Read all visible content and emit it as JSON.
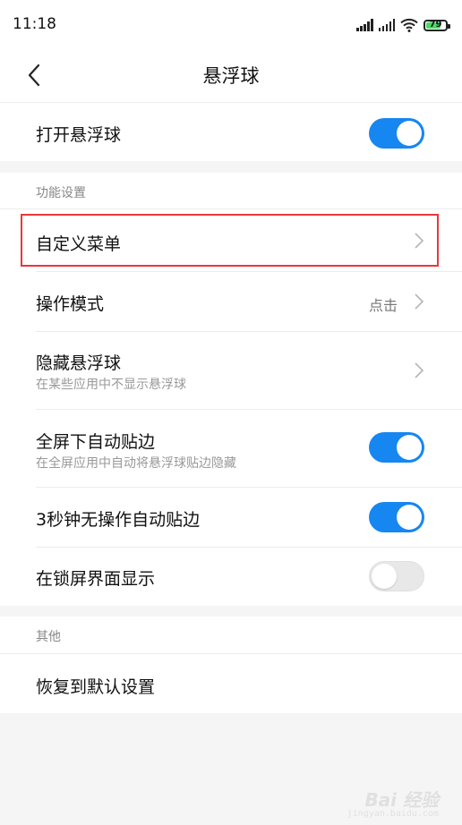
{
  "status_bar": {
    "time": "11:18",
    "battery_level": "79",
    "battery_fraction": 0.79,
    "icons": [
      "signal-icon",
      "signal-icon",
      "wifi-icon",
      "battery-icon"
    ]
  },
  "header": {
    "title": "悬浮球",
    "back_icon": "chevron-left-icon"
  },
  "top_row": {
    "label": "打开悬浮球",
    "toggle_on": true
  },
  "sections": {
    "function_label": "功能设置",
    "other_label": "其他"
  },
  "settings": [
    {
      "label": "自定义菜单",
      "type": "nav"
    },
    {
      "label": "操作模式",
      "type": "nav",
      "value": "点击"
    },
    {
      "label": "隐藏悬浮球",
      "subtitle": "在某些应用中不显示悬浮球",
      "type": "nav"
    },
    {
      "label": "全屏下自动贴边",
      "subtitle": "在全屏应用中自动将悬浮球贴边隐藏",
      "type": "toggle",
      "on": true
    },
    {
      "label": "3秒钟无操作自动贴边",
      "type": "toggle",
      "on": true
    },
    {
      "label": "在锁屏界面显示",
      "type": "toggle",
      "on": false
    }
  ],
  "other": [
    {
      "label": "恢复到默认设置",
      "type": "action"
    }
  ],
  "colors": {
    "accent": "#1686f0",
    "highlight": "#e8373d",
    "background": "#f5f5f5"
  },
  "watermark": {
    "brand": "Bai 经验",
    "url": "jingyan.baidu.com"
  }
}
